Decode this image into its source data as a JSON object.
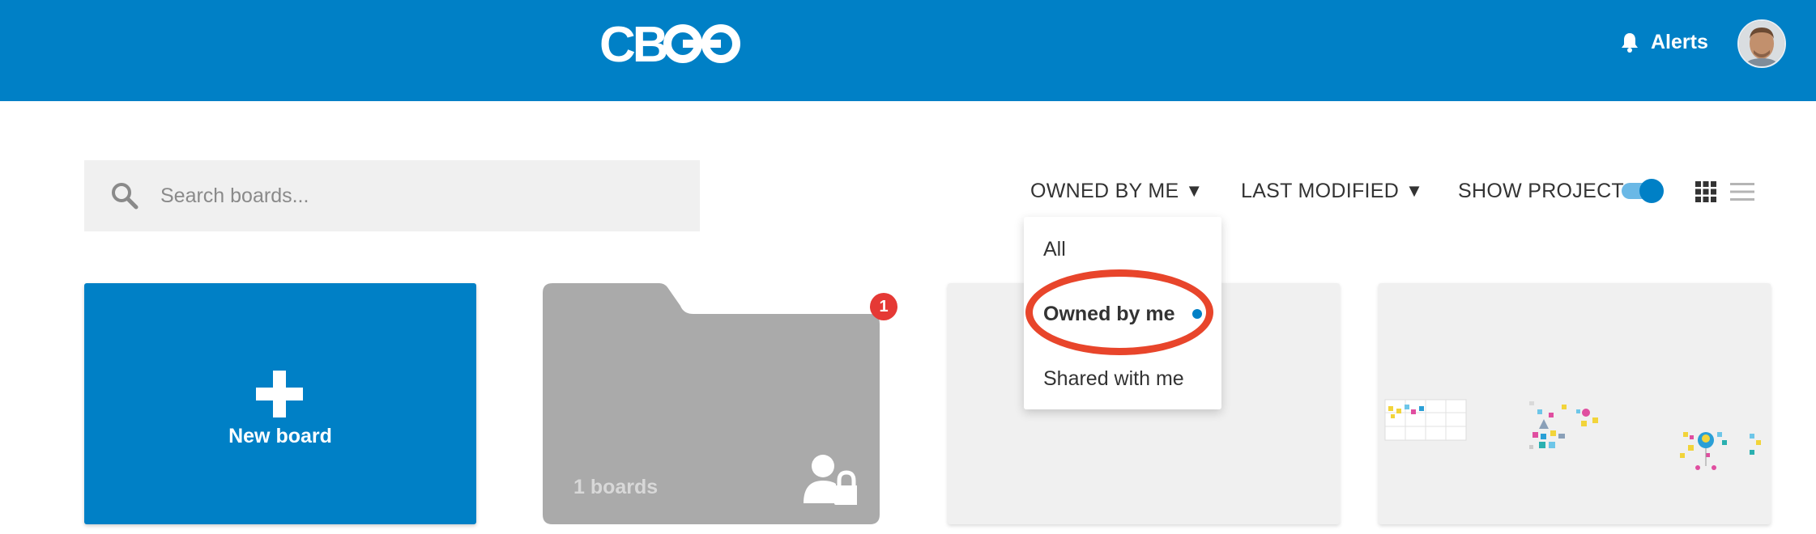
{
  "header": {
    "logo_text": "CB",
    "alerts_label": "Alerts"
  },
  "search": {
    "placeholder": "Search boards..."
  },
  "filters": {
    "owner_label": "OWNED BY ME",
    "owner_arrow": "▼",
    "sort_label": "LAST MODIFIED",
    "sort_arrow": "▼",
    "show_projects_label": "SHOW PROJECTS",
    "show_projects_on": true
  },
  "owner_dropdown": {
    "options": [
      "All",
      "Owned by me",
      "Shared with me"
    ],
    "selected": "Owned by me"
  },
  "cards": {
    "new_board_label": "New board",
    "folder_count_label": "1 boards",
    "folder_badge": "1"
  },
  "colors": {
    "brand_blue": "#0080c6",
    "highlight_red": "#e8452b",
    "badge_red": "#e53935"
  }
}
